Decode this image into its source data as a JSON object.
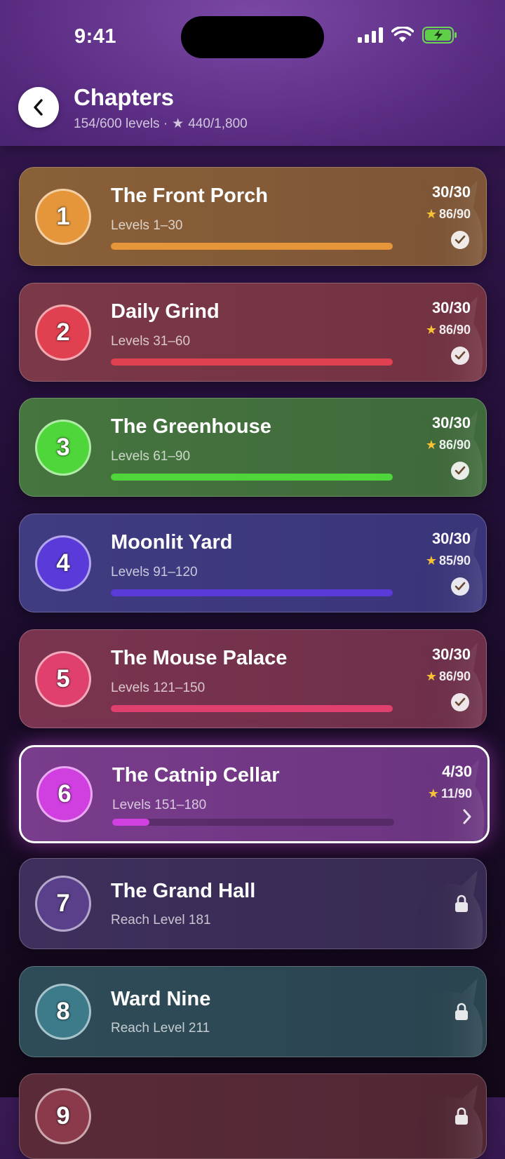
{
  "status": {
    "time": "9:41"
  },
  "header": {
    "title": "Chapters",
    "levels_progress": "154/600 levels ·",
    "stars_progress": "440/1,800"
  },
  "colors": {
    "star": "#f7c233"
  },
  "chapters": [
    {
      "number": "1",
      "title": "The Front Porch",
      "subtitle": "Levels 1–30",
      "count": "30/30",
      "stars": "86/90",
      "progress": 1.0,
      "state": "complete",
      "accent": "#e5963a"
    },
    {
      "number": "2",
      "title": "Daily Grind",
      "subtitle": "Levels 31–60",
      "count": "30/30",
      "stars": "86/90",
      "progress": 1.0,
      "state": "complete",
      "accent": "#e0404f"
    },
    {
      "number": "3",
      "title": "The Greenhouse",
      "subtitle": "Levels 61–90",
      "count": "30/30",
      "stars": "86/90",
      "progress": 1.0,
      "state": "complete",
      "accent": "#4fd63a"
    },
    {
      "number": "4",
      "title": "Moonlit Yard",
      "subtitle": "Levels 91–120",
      "count": "30/30",
      "stars": "85/90",
      "progress": 1.0,
      "state": "complete",
      "accent": "#5a3ad8"
    },
    {
      "number": "5",
      "title": "The Mouse Palace",
      "subtitle": "Levels 121–150",
      "count": "30/30",
      "stars": "86/90",
      "progress": 1.0,
      "state": "complete",
      "accent": "#e0406e"
    },
    {
      "number": "6",
      "title": "The Catnip Cellar",
      "subtitle": "Levels 151–180",
      "count": "4/30",
      "stars": "11/90",
      "progress": 0.133,
      "state": "current",
      "accent": "#d03fe0"
    },
    {
      "number": "7",
      "title": "The Grand Hall",
      "subtitle": "Reach Level 181",
      "state": "locked",
      "accent": "#5a3f8a"
    },
    {
      "number": "8",
      "title": "Ward Nine",
      "subtitle": "Reach Level 211",
      "state": "locked",
      "accent": "#3d7a8a"
    },
    {
      "number": "9",
      "title": "",
      "subtitle": "",
      "state": "locked",
      "accent": "#8a3a4a"
    }
  ]
}
